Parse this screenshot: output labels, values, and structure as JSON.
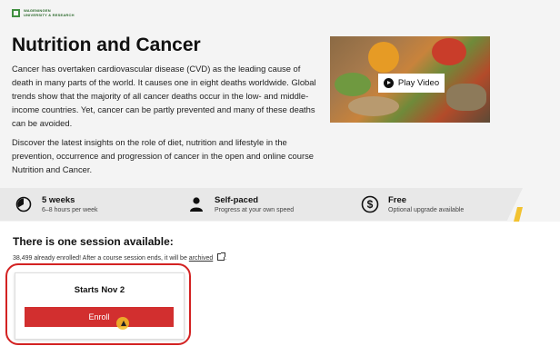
{
  "brand": {
    "logo_line1": "WAGENINGEN",
    "logo_line2": "UNIVERSITY & RESEARCH"
  },
  "hero": {
    "title": "Nutrition and Cancer",
    "description": "Cancer has overtaken cardiovascular disease (CVD) as the leading cause of death in many parts of the world. It causes one in eight deaths worldwide. Global trends show that the majority of all cancer deaths occur in the low- and middle-income countries. Yet, cancer can be partly prevented and many of these deaths can be avoided.",
    "description2": "Discover the latest insights on the role of diet, nutrition and lifestyle in the prevention, occurrence and progression of cancer in the open and online course Nutrition and Cancer.",
    "video_button_label": "Play Video"
  },
  "stats": [
    {
      "icon": "clock-icon",
      "title": "5 weeks",
      "subtitle": "6–8 hours per week"
    },
    {
      "icon": "person-icon",
      "title": "Self-paced",
      "subtitle": "Progress at your own speed"
    },
    {
      "icon": "dollar-icon",
      "title": "Free",
      "subtitle": "Optional upgrade available"
    }
  ],
  "session": {
    "heading": "There is one session available:",
    "note_prefix": "38,499 already enrolled! After a course session ends, it will be",
    "note_link": "archived",
    "note_suffix": ".",
    "card_title": "Starts Nov 2",
    "enroll_label": "Enroll"
  },
  "colors": {
    "enroll": "#d22f2f",
    "highlight": "#d32222",
    "accent": "#f2c230",
    "brand_green": "#3f8f3f"
  }
}
